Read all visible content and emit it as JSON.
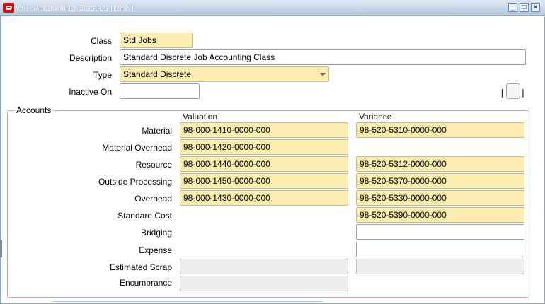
{
  "window": {
    "title": "WIP Accounting Classes (DYN)",
    "buttons": [
      "minimize-icon",
      "maximize-icon",
      "close-icon"
    ]
  },
  "header_fields": {
    "class": {
      "label": "Class",
      "value": "Std Jobs"
    },
    "description": {
      "label": "Description",
      "value": "Standard Discrete Job Accounting Class"
    },
    "type": {
      "label": "Type",
      "value": "Standard Discrete"
    },
    "inactive_on": {
      "label": "Inactive On",
      "value": ""
    },
    "flex_bracket_left": "[",
    "flex_bracket_right": "]"
  },
  "accounts": {
    "legend": "Accounts",
    "valuation_header": "Valuation",
    "variance_header": "Variance",
    "rows": [
      {
        "label": "Material",
        "valuation": "98-000-1410-0000-000",
        "variance": "98-520-5310-0000-000"
      },
      {
        "label": "Material Overhead",
        "valuation": "98-000-1420-0000-000",
        "variance": ""
      },
      {
        "label": "Resource",
        "valuation": "98-000-1440-0000-000",
        "variance": "98-520-5312-0000-000"
      },
      {
        "label": "Outside Processing",
        "valuation": "98-000-1450-0000-000",
        "variance": "98-520-5370-0000-000"
      },
      {
        "label": "Overhead",
        "valuation": "98-000-1430-0000-000",
        "variance": "98-520-5330-0000-000"
      },
      {
        "label": "Standard Cost",
        "valuation": "",
        "variance": "98-520-5390-0000-000"
      },
      {
        "label": "Bridging",
        "valuation": "",
        "variance": ""
      },
      {
        "label": "Expense",
        "valuation": "",
        "variance": ""
      },
      {
        "label": "Estimated Scrap",
        "valuation": "",
        "variance": ""
      },
      {
        "label": "Encumbrance",
        "valuation": "",
        "variance": ""
      }
    ]
  },
  "colors": {
    "required_field": "#fcedb3",
    "disabled_field": "#eeeeee",
    "title_bar": "#b8c9e0",
    "oracle_red": "#d01010"
  }
}
